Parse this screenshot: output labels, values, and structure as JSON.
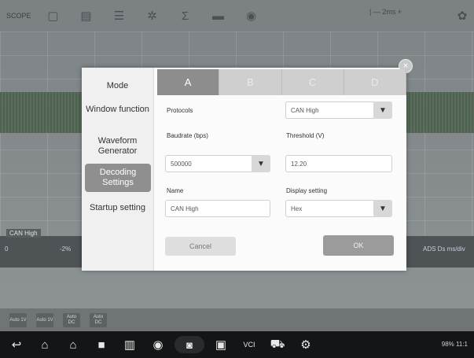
{
  "toolbar": {
    "mode_label": "SCOPE",
    "zoom_label": "| — 2ms +",
    "icons": [
      "square-icon",
      "document-icon",
      "sliders-icon",
      "gear-icon",
      "sigma-icon",
      "folder-icon",
      "chip-icon",
      "settings-icon"
    ]
  },
  "scope": {
    "tag_left": "CAN High",
    "pct_left": "0",
    "pct_mid": "-2%",
    "right_value": "ADS Ds ms/div"
  },
  "menu": {
    "items": [
      {
        "label": "Mode"
      },
      {
        "label": "Window function"
      },
      {
        "label": "Waveform Generator"
      },
      {
        "label": "Decoding Settings"
      },
      {
        "label": "Startup setting"
      }
    ]
  },
  "tabs": [
    {
      "label": "A"
    },
    {
      "label": "B"
    },
    {
      "label": "C"
    },
    {
      "label": "D"
    }
  ],
  "form": {
    "protocols_label": "Protocols",
    "protocols_value": "CAN High",
    "baudrate_label": "Baudrate (bps)",
    "baudrate_value": "500000",
    "threshold_label": "Threshold (V)",
    "threshold_value": "12.20",
    "name_label": "Name",
    "name_value": "CAN High",
    "display_label": "Display setting",
    "display_value": "Hex"
  },
  "buttons": {
    "cancel": "Cancel",
    "ok": "OK",
    "close": "×"
  },
  "bottom_toolbar": {
    "buttons": [
      "Auto 1V",
      "Auto 1V",
      "Auto DC",
      "Auto DC"
    ]
  },
  "status_bar": {
    "right": "98% 11:1"
  }
}
